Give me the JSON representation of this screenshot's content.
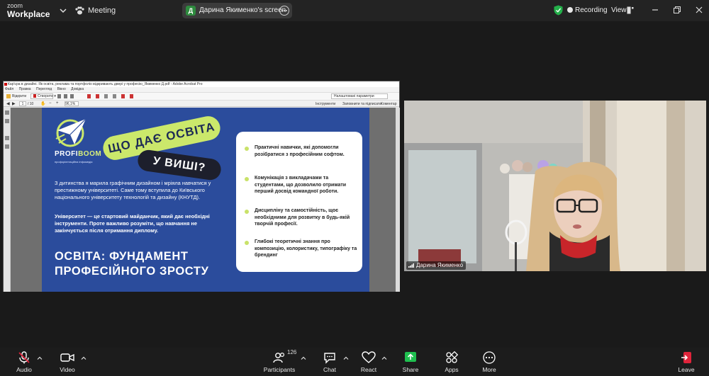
{
  "app": {
    "brand_top": "zoom",
    "brand_bottom": "Workplace"
  },
  "topbar": {
    "meeting_label": "Meeting",
    "screen_chip": {
      "avatar_letter": "Д",
      "label": "Дарина Якименко's screen"
    },
    "recording_label": "Recording",
    "view_label": "View"
  },
  "acrobat": {
    "window_title": "Кар'єра в дизайні. Як освіта, реклама та портфоліо відкривають двері у професію_Якименко Д.pdf - Adobe Acrobat Pro",
    "menu": [
      "Файл",
      "Правка",
      "Перегляд",
      "Вікно",
      "Довідка"
    ],
    "toolbar1": {
      "open_label": "Відкрити",
      "create_label": "Створити ▾",
      "custom_label": "Налаштовані параметри"
    },
    "toolbar2": {
      "page_current": "1",
      "page_total": "/ 10",
      "zoom": "96,1%",
      "tools_label": "Інструменти",
      "sign_label": "Заповнити та підписати",
      "comment_label": "Коментар"
    }
  },
  "slide": {
    "logo_word_a": "PROFI",
    "logo_word_b": "BOOM",
    "logo_sub": "профорієнтаційна інфомедія",
    "tag_1": "ЩО ДАЄ ОСВІТА",
    "tag_2": "У ВИШІ?",
    "paragraph_1": "З дитинства я марила графічним дизайном і мріяла навчатися у престижному університеті. Саме тому вступила до Київського національного університету технологій та дизайну (КНУТД).",
    "paragraph_2": "Університет — це стартовий майданчик, який дає необхідні інструменти. Проте важливо розуміти, що навчання не закінчується після отримання диплому.",
    "headline_line1": "ОСВІТА: ФУНДАМЕНТ",
    "headline_line2": "ПРОФЕСІЙНОГО ЗРОСТУ",
    "card_items": [
      "Практичні навички, які допомогли розібратися з професійним софтом.",
      "Комунікація з викладачами та студентами, що дозволило отримати перший досвід командної роботи.",
      "Дисципліну та самостійність, щоє необхідними для розвитку в будь-якій творчій професії.",
      "Глибокі теоретичні знання про композицію, колористику, типографіку та брендинг"
    ]
  },
  "video": {
    "participant_name": "Дарина Якименко"
  },
  "bottombar": {
    "audio_label": "Audio",
    "video_label": "Video",
    "participants_label": "Participants",
    "participants_count": "126",
    "chat_label": "Chat",
    "react_label": "React",
    "share_label": "Share",
    "apps_label": "Apps",
    "more_label": "More",
    "leave_label": "Leave"
  },
  "colors": {
    "share_green": "#1fbf4f",
    "leave_red": "#e0243b",
    "slide_blue": "#2b4c9c",
    "slide_lime": "#cbe86b",
    "shield_green": "#24b04a"
  }
}
